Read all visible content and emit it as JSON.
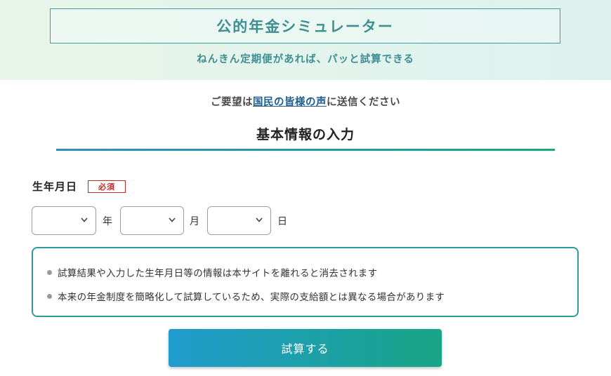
{
  "header": {
    "title": "公的年金シミュレーター",
    "subtitle": "ねんきん定期便があれば、パッと試算できる"
  },
  "request": {
    "prefix": "ご要望は",
    "link_text": "国民の皆様の声",
    "suffix": "に送信ください"
  },
  "section": {
    "title": "基本情報の入力"
  },
  "birthdate": {
    "label": "生年月日",
    "required_badge": "必須",
    "year_value": "",
    "month_value": "",
    "day_value": "",
    "year_unit": "年",
    "month_unit": "月",
    "day_unit": "日"
  },
  "notice": {
    "items": [
      "試算結果や入力した生年月日等の情報は本サイトを離れると消去されます",
      "本来の年金制度を簡略化して試算しているため、実際の支給額とは異なる場合があります"
    ]
  },
  "submit": {
    "label": "試算する"
  },
  "colors": {
    "accent_teal": "#3f8e92",
    "required_red": "#c62828",
    "link_blue": "#1d5f8c",
    "button_gradient_start": "#1f9bcd",
    "button_gradient_end": "#19a586"
  },
  "icons": {
    "select_indicator": "chevron-down-icon",
    "bullet": "bullet-dot"
  }
}
